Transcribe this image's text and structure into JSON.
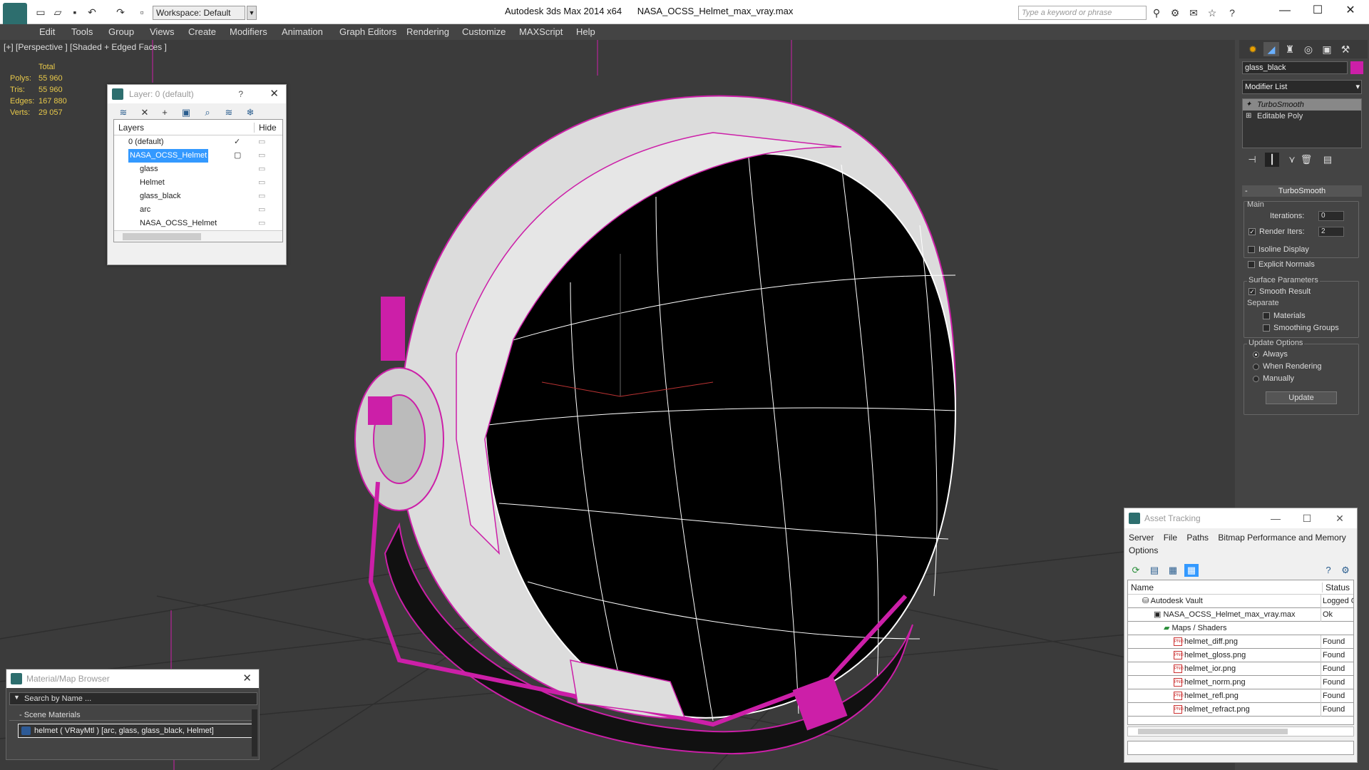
{
  "app": {
    "name": "Autodesk 3ds Max  2014 x64",
    "file": "NASA_OCSS_Helmet_max_vray.max",
    "workspace": "Workspace: Default",
    "search_placeholder": "Type a keyword or phrase"
  },
  "menu": [
    "Edit",
    "Tools",
    "Group",
    "Views",
    "Create",
    "Modifiers",
    "Animation",
    "Graph Editors",
    "Rendering",
    "Customize",
    "MAXScript",
    "Help"
  ],
  "viewport": {
    "label": "[+] [Perspective ] [Shaded + Edged Faces ]",
    "stats": {
      "header": "Total",
      "rows": [
        {
          "k": "Polys:",
          "v": "55 960"
        },
        {
          "k": "Tris:",
          "v": "55 960"
        },
        {
          "k": "Edges:",
          "v": "167 880"
        },
        {
          "k": "Verts:",
          "v": "29 057"
        }
      ]
    },
    "wire_color": "#cc1fa8",
    "edge_color": "#ffffff"
  },
  "layer_dialog": {
    "title": "Layer: 0 (default)",
    "help": "?",
    "col_layers": "Layers",
    "col_hide": "Hide",
    "rows": [
      {
        "name": "0 (default)",
        "level": 0,
        "active": true
      },
      {
        "name": "NASA_OCSS_Helmet",
        "level": 0,
        "selected": true
      },
      {
        "name": "glass",
        "level": 1
      },
      {
        "name": "Helmet",
        "level": 1
      },
      {
        "name": "glass_black",
        "level": 1
      },
      {
        "name": "arc",
        "level": 1
      },
      {
        "name": "NASA_OCSS_Helmet",
        "level": 1
      }
    ]
  },
  "command_panel": {
    "object_name": "glass_black",
    "object_color": "#cc1fa8",
    "modifier_list": "Modifier List",
    "stack": [
      "TurboSmooth",
      "Editable Poly"
    ],
    "rollout": "TurboSmooth",
    "main_label": "Main",
    "iterations_label": "Iterations:",
    "iterations": "0",
    "render_iters_label": "Render Iters:",
    "render_iters": "2",
    "isoline": "Isoline Display",
    "explicit_normals": "Explicit Normals",
    "surface_params": "Surface Parameters",
    "smooth_result": "Smooth Result",
    "separate": "Separate",
    "materials": "Materials",
    "smoothing_groups": "Smoothing Groups",
    "update_options": "Update Options",
    "always": "Always",
    "when_rendering": "When Rendering",
    "manually": "Manually",
    "update_button": "Update"
  },
  "asset_tracking": {
    "title": "Asset Tracking",
    "menu": [
      "Server",
      "File",
      "Paths",
      "Bitmap Performance and Memory",
      "Options"
    ],
    "col_name": "Name",
    "col_status": "Status",
    "rows": [
      {
        "name": "Autodesk Vault",
        "status": "Logged O",
        "level": 0
      },
      {
        "name": "NASA_OCSS_Helmet_max_vray.max",
        "status": "Ok",
        "level": 1
      },
      {
        "name": "Maps / Shaders",
        "status": "",
        "level": 2
      },
      {
        "name": "helmet_diff.png",
        "status": "Found",
        "level": 3
      },
      {
        "name": "helmet_gloss.png",
        "status": "Found",
        "level": 3
      },
      {
        "name": "helmet_ior.png",
        "status": "Found",
        "level": 3
      },
      {
        "name": "helmet_norm.png",
        "status": "Found",
        "level": 3
      },
      {
        "name": "helmet_refl.png",
        "status": "Found",
        "level": 3
      },
      {
        "name": "helmet_refract.png",
        "status": "Found",
        "level": 3
      }
    ]
  },
  "material_browser": {
    "title": "Material/Map Browser",
    "search": "Search by Name ...",
    "section": "- Scene Materials",
    "material": "helmet  ( VRayMtl )  [arc, glass, glass_black, Helmet]"
  }
}
